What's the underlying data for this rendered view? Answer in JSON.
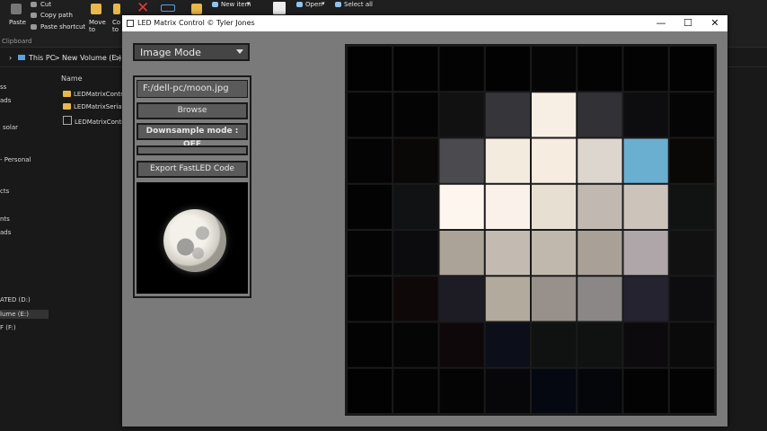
{
  "explorer": {
    "ribbon": {
      "paste": "Paste",
      "cut": "Cut",
      "copy_path": "Copy path",
      "paste_shortcut": "Paste shortcut",
      "move_to": "Move to",
      "copy_to": "Co to",
      "new_item": "New item",
      "open": "Open",
      "select_all": "Select all",
      "clipboard_group": "Clipboard"
    },
    "address": [
      "This PC",
      ">",
      "New Volume (E:)",
      ">"
    ],
    "nav_items": [
      "ss",
      "ads",
      "solar",
      "- Personal",
      "cts",
      "nts",
      "ads",
      "ATED (D:)",
      "lume (E:)",
      "F (F:)"
    ],
    "column_name": "Name",
    "files": [
      "LEDMatrixContr",
      "LEDMatrixSerial",
      "LEDMatrixContr"
    ]
  },
  "app": {
    "title": "LED Matrix Control © Tyler Jones",
    "window_buttons": {
      "minimize": "—",
      "maximize": "☐",
      "close": "✕"
    },
    "mode": "Image Mode",
    "file_path": "F:/dell-pc/moon.jpg",
    "browse_label": "Browse",
    "downsample_label": "Downsample mode : OFF",
    "progress_fraction": 0,
    "export_label": "Export FastLED Code",
    "colors": {
      "accent_cell": "#6aaed0",
      "panel": "#7d7d7d",
      "control": "#5a5a5a"
    }
  },
  "matrix": {
    "rows": 8,
    "cols": 8,
    "cells": [
      [
        "#020202",
        "#020202",
        "#030303",
        "#020202",
        "#050505",
        "#030303",
        "#030303",
        "#020202"
      ],
      [
        "#030303",
        "#040404",
        "#111111",
        "#35353a",
        "#f7efe4",
        "#323236",
        "#0d0d0f",
        "#050505"
      ],
      [
        "#040404",
        "#0a0707",
        "#4a4a4f",
        "#f3ebdd",
        "#f6ece0",
        "#ddd6cf",
        "#6aaed0",
        "#0a0707"
      ],
      [
        "#030303",
        "#111213",
        "#fdf6ef",
        "#faf1ea",
        "#e8dfd3",
        "#c1b9b1",
        "#ccc3bb",
        "#111212"
      ],
      [
        "#040404",
        "#0c0b0d",
        "#aca398",
        "#c3bab1",
        "#c0b8ad",
        "#a9a197",
        "#aea6a8",
        "#111111"
      ],
      [
        "#030303",
        "#0e0809",
        "#1d1c24",
        "#b3aa9e",
        "#98918b",
        "#8b8787",
        "#262330",
        "#0d0d0f"
      ],
      [
        "#030303",
        "#050505",
        "#0e080a",
        "#0c0f1a",
        "#101212",
        "#101111",
        "#0c0a0d",
        "#0a0a0a"
      ],
      [
        "#020202",
        "#030303",
        "#040405",
        "#070709",
        "#050811",
        "#050609",
        "#030304",
        "#030303"
      ]
    ]
  }
}
